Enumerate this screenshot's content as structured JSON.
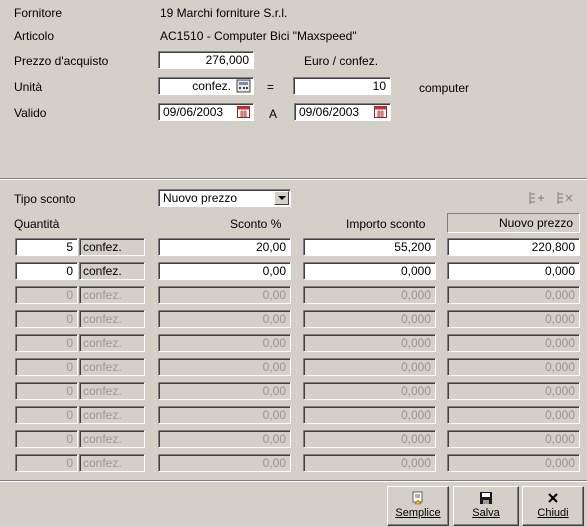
{
  "header": {
    "fornitore_label": "Fornitore",
    "fornitore_value": "19  Marchi forniture S.r.l.",
    "articolo_label": "Articolo",
    "articolo_value": "AC1510 - Computer Bici \"Maxspeed\"",
    "prezzo_label": "Prezzo d'acquisto",
    "prezzo_value": "276,000",
    "prezzo_unit": "Euro / confez.",
    "unita_label": "Unità",
    "unita_value": "confez.",
    "equals": "=",
    "conv_value": "10",
    "conv_unit": "computer",
    "valido_label": "Valido",
    "valido_from": "09/06/2003",
    "valido_sep": "A",
    "valido_to": "09/06/2003"
  },
  "discount": {
    "tipo_label": "Tipo sconto",
    "tipo_value": "Nuovo prezzo",
    "col_quantita": "Quantità",
    "col_sconto": "Sconto %",
    "col_importo": "Importo sconto",
    "col_nuovo": "Nuovo prezzo",
    "rows": [
      {
        "qty": "5",
        "unit": "confez.",
        "sconto": "20,00",
        "importo": "55,200",
        "nuovo": "220,800",
        "enabled": true
      },
      {
        "qty": "0",
        "unit": "confez.",
        "sconto": "0,00",
        "importo": "0,000",
        "nuovo": "0,000",
        "enabled": true
      },
      {
        "qty": "0",
        "unit": "confez.",
        "sconto": "0,00",
        "importo": "0,000",
        "nuovo": "0,000",
        "enabled": false
      },
      {
        "qty": "0",
        "unit": "confez.",
        "sconto": "0,00",
        "importo": "0,000",
        "nuovo": "0,000",
        "enabled": false
      },
      {
        "qty": "0",
        "unit": "confez.",
        "sconto": "0,00",
        "importo": "0,000",
        "nuovo": "0,000",
        "enabled": false
      },
      {
        "qty": "0",
        "unit": "confez.",
        "sconto": "0,00",
        "importo": "0,000",
        "nuovo": "0,000",
        "enabled": false
      },
      {
        "qty": "0",
        "unit": "confez.",
        "sconto": "0,00",
        "importo": "0,000",
        "nuovo": "0,000",
        "enabled": false
      },
      {
        "qty": "0",
        "unit": "confez.",
        "sconto": "0,00",
        "importo": "0,000",
        "nuovo": "0,000",
        "enabled": false
      },
      {
        "qty": "0",
        "unit": "confez.",
        "sconto": "0,00",
        "importo": "0,000",
        "nuovo": "0,000",
        "enabled": false
      },
      {
        "qty": "0",
        "unit": "confez.",
        "sconto": "0,00",
        "importo": "0,000",
        "nuovo": "0,000",
        "enabled": false
      }
    ]
  },
  "buttons": {
    "semplice": "Semplice",
    "salva": "Salva",
    "chiudi": "Chiudi"
  },
  "icons": {
    "calc": "calculator-icon",
    "calendar": "calendar-icon",
    "insert_row": "insert-row-icon",
    "delete_row": "delete-row-icon",
    "save": "floppy-disk-icon",
    "close": "close-x-icon",
    "simple": "simple-view-icon"
  }
}
